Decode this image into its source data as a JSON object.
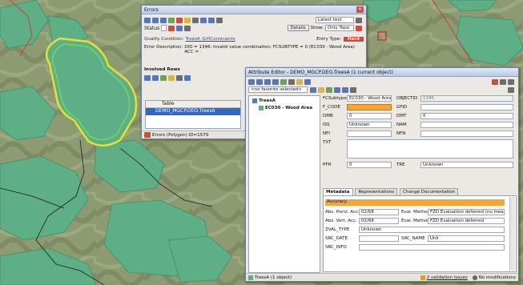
{
  "errors_window": {
    "title": "Errors",
    "filter_select": "Latest text",
    "status_label": "Status",
    "details_button": "Details",
    "show_label": "Show:",
    "show_select": "Only Topo",
    "quality_condition_label": "Quality Condition:",
    "quality_condition_value": "TreesA_GrfIConstraints",
    "entry_type_label": "Entry Type:",
    "entry_type_value": "Hard",
    "error_description_label": "Error Description:",
    "error_description_value": "DID = 1346: Invalid value combination: FCSUBTYPE = 0 (EC030 · Wood Area) ACC = ·",
    "involved_rows_label": "Involved Rows",
    "table_header": "Table",
    "table_row": "DEMO_MGCP.DEO.TreesA",
    "status_bar": "Errors (Polygon) ID=1579"
  },
  "attr_window": {
    "title": "Attribute Editor - DEMO_MGCP.DEO.TreesA (1 current object)",
    "favorites_select": "<no favorite selected>",
    "tree_root": "TreesA",
    "tree_child": "EC030 - Wood Area",
    "fields": {
      "fcsubtype_label": "FCSubtype",
      "fcsubtype_value": "EC030 - Wood Area",
      "objectid_label": "OBJECTID",
      "objectid_value": "1345",
      "fcode_label": "F_CODE",
      "gfid_label": "GFID",
      "dmb_label": "DMB",
      "dmb_value": "0",
      "dmt_label": "DMT",
      "dmt_value": "0",
      "iss_label": "ISS",
      "iss_value": "Unknown",
      "nam_label": "NAM",
      "nfi_label": "NFI",
      "nfn_label": "NFN",
      "txt_label": "TXT",
      "pfh_label": "PFH",
      "pfh_value": "0",
      "tre_label": "TRE",
      "tre_value": "Unknown"
    },
    "tabs": [
      "Metadata",
      "Representations",
      "Change Documentation"
    ],
    "meta": {
      "accuracy_label": "Accuracy",
      "abs_horiz_label": "Abs. Horiz. Acc.",
      "abs_horiz_value": "02/68",
      "eval_method_label": "Eval. Method",
      "eval_method_1": "FZD Evaluation deferred (no meas.)",
      "abs_vert_label": "Abs. Vert. Acc.",
      "abs_vert_value": "02/68",
      "eval_method_2": "FZD Evaluation deferred",
      "zval_type_label": "ZVAL_TYPE",
      "zval_type_value": "Unknown",
      "src_date_label": "SRC_DATE",
      "src_name_label": "SRC_NAME",
      "src_name_value": "Unk",
      "src_info_label": "SRC_INFO"
    },
    "status_left": "TreesA (1 object)",
    "status_validation": "2 validation issues",
    "status_mods": "No modifications"
  },
  "colors": {
    "forest": "#5faf86",
    "map_bg": "#8d9b72",
    "highlight_line": "#e8e030",
    "accent_orange": "#f4a63a",
    "hard_red": "#d0483a",
    "selected_row": "#3168c8"
  }
}
